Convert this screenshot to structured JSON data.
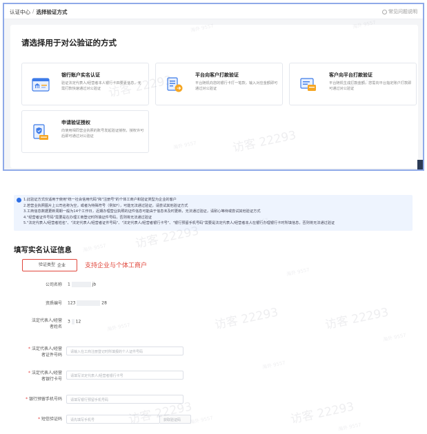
{
  "top": {
    "breadcrumb": [
      "认证中心",
      "选择验证方式"
    ],
    "help": "常见问题说明",
    "panel_title": "请选择用于对公验证的方式",
    "cards": [
      {
        "icon": "bank-card-icon",
        "title": "银行账户实名认证",
        "desc": "验证法定代表人/经营者本人银行卡四要素信息，无需打款快速通过对公验证"
      },
      {
        "icon": "transfer-icon",
        "title": "平台向客户打款验证",
        "desc": "平台随机向您的银行卡打一笔款，输入对应金额即可通过对公验证"
      },
      {
        "icon": "customer-pay-icon",
        "title": "客户向平台打款验证",
        "desc": "平台随机生成打款金额，您需向平台指定账户打款即可通过对公验证"
      },
      {
        "icon": "authorization-icon",
        "title": "申请验证授权",
        "desc": "向使用相同营业执照的账号发起验证授权，授权许可后即可通过对公验证"
      }
    ]
  },
  "watermark": {
    "big": "访客 22293",
    "small": "海外 9557"
  },
  "notice": [
    "1.此验证方式仅适用于使用\"统一社会信用代码\"和\"注册号\"的个体工商户和验证类型为企业的客户",
    "2.若营业执照图片上公司名称为空，或者为特殊符号（例如*），可能无法通过验证，请尝试其他验证方式",
    "3.工商信息数据更新周期一般为14个工作日，近期办理营业执照的证件信息可能由于信息未及时更新，无法通过验证，请耐心等待或尝试其他验证方式",
    "4.\"经营者证件号码\"需要是在办理工商登记时所填证件号码，否则将无法通过验证",
    "5.\"法定代表人/经营者姓名\"、\"法定代表人/经营者证件号码\"、\"法定代表人/经营者银行卡号\"、\"银行预留手机号码\"需要是法定代表人/经营者本人在银行办理银行卡时所填信息，否则将无法通过验证"
  ],
  "form": {
    "title": "填写实名认证信息",
    "type_label": "验证类型",
    "type_value": "企业",
    "type_note": "支持企业与个体工商户",
    "company_label": "公司名称",
    "company_value_start": "1",
    "company_value_end": "jb",
    "license_label": "资质编号",
    "license_value_start": "123",
    "license_value_end": "28",
    "legal_name_label_1": "法定代表人/经营",
    "legal_name_label_2": "者姓名",
    "legal_name_value_start": "3",
    "legal_name_value_end": "12",
    "id_label_1": "法定代表人/经营",
    "id_label_2": "者证件号码",
    "id_placeholder": "请输入在工商注册登记时所填报的个人证件号码",
    "card_label_1": "法定代表人/经营",
    "card_label_2": "者银行卡号",
    "card_placeholder": "请填写法定代表人/经营者银行卡号",
    "phone_label": "银行预留手机号码",
    "phone_placeholder": "请填写银行预留手机号码",
    "sms_label": "短信验证码",
    "sms_placeholder": "请先填写手机号",
    "sms_button": "获取验证码"
  }
}
